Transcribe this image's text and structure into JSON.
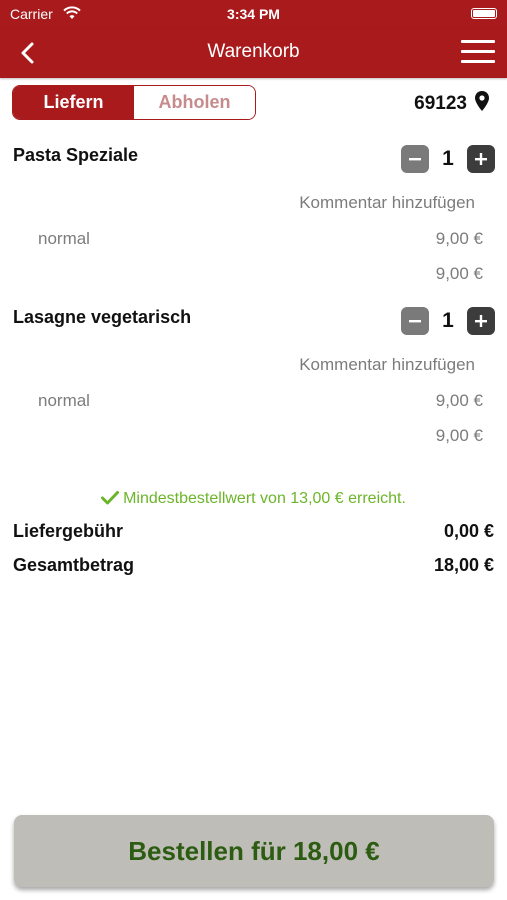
{
  "status_bar": {
    "carrier": "Carrier",
    "time": "3:34 PM"
  },
  "nav": {
    "title": "Warenkorb"
  },
  "delivery_mode": {
    "options": [
      "Liefern",
      "Abholen"
    ],
    "selected": "Liefern"
  },
  "zip": "69123",
  "items": [
    {
      "name": "Pasta Speziale",
      "quantity": "1",
      "comment_label": "Kommentar hinzufügen",
      "variant": "normal",
      "variant_price": "9,00 €",
      "item_total": "9,00 €"
    },
    {
      "name": "Lasagne vegetarisch",
      "quantity": "1",
      "comment_label": "Kommentar hinzufügen",
      "variant": "normal",
      "variant_price": "9,00 €",
      "item_total": "9,00 €"
    }
  ],
  "minimum_order": {
    "text": "Mindestbestellwert von 13,00 € erreicht.",
    "color": "#6cb52a"
  },
  "summary": {
    "delivery_fee_label": "Liefergebühr",
    "delivery_fee_value": "0,00 €",
    "total_label": "Gesamtbetrag",
    "total_value": "18,00 €"
  },
  "order_button": {
    "label": "Bestellen für 18,00 €"
  },
  "colors": {
    "brand": "#a81a1c",
    "success": "#6cb52a",
    "order_text": "#2c5b12",
    "order_bg": "#bfbdb7"
  }
}
